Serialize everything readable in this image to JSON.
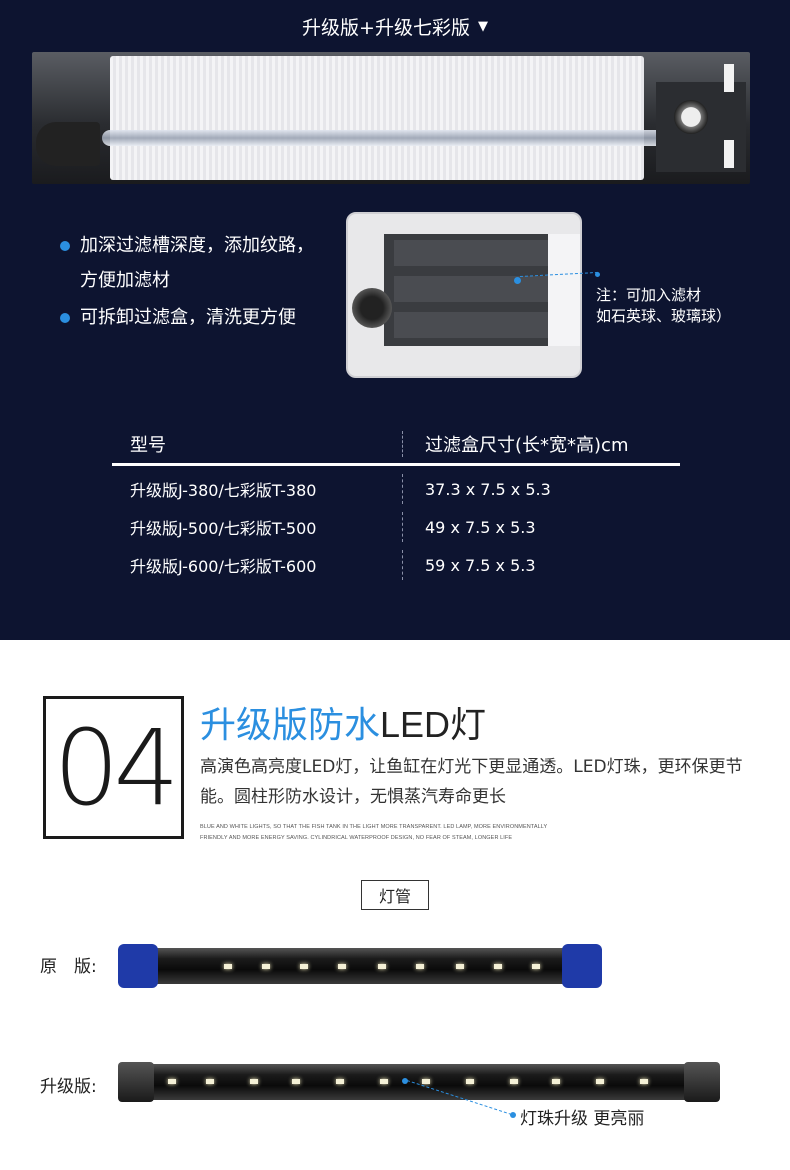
{
  "variant_selector": {
    "label": "升级版+升级七彩版",
    "caret": "▼"
  },
  "filter_features": [
    "加深过滤槽深度，添加纹路，方便加滤材",
    "可拆卸过滤盒，清洗更方便"
  ],
  "inset_note": {
    "line1": "注：可加入滤材",
    "line2": "如石英球、玻璃球）"
  },
  "spec_table": {
    "headers": [
      "型号",
      "过滤盒尺寸(长*宽*高)cm"
    ],
    "rows": [
      {
        "model": "升级版J-380/七彩版T-380",
        "size": "37.3 x 7.5 x 5.3"
      },
      {
        "model": "升级版J-500/七彩版T-500",
        "size": "49 x 7.5 x 5.3"
      },
      {
        "model": "升级版J-600/七彩版T-600",
        "size": "59 x 7.5 x 5.3"
      }
    ]
  },
  "led_section": {
    "number": "04",
    "title_cn": "升级版防水",
    "title_latin": "LED",
    "title_end": "灯",
    "description": "高演色高亮度LED灯，让鱼缸在灯光下更显通透。LED灯珠，更环保更节能。圆柱形防水设计，无惧蒸汽寿命更长",
    "fine_print": "BLUE AND WHITE LIGHTS, SO THAT THE FISH TANK IN THE LIGHT MORE TRANSPARENT. LED LAMP, MORE ENVIRONMENTALLY FRIENDLY AND MORE ENERGY SAVING. CYLINDRICAL WATERPROOF DESIGN, NO FEAR OF STEAM, LONGER LIFE",
    "tube_tag": "灯管",
    "original_label": "原　版:",
    "upgraded_label": "升级版:",
    "bead_callout": "灯珠升级 更亮丽"
  },
  "colors": {
    "dark_bg": "#0d1430",
    "accent_blue": "#2b8fe0",
    "cap_blue": "#1f3aa8"
  }
}
